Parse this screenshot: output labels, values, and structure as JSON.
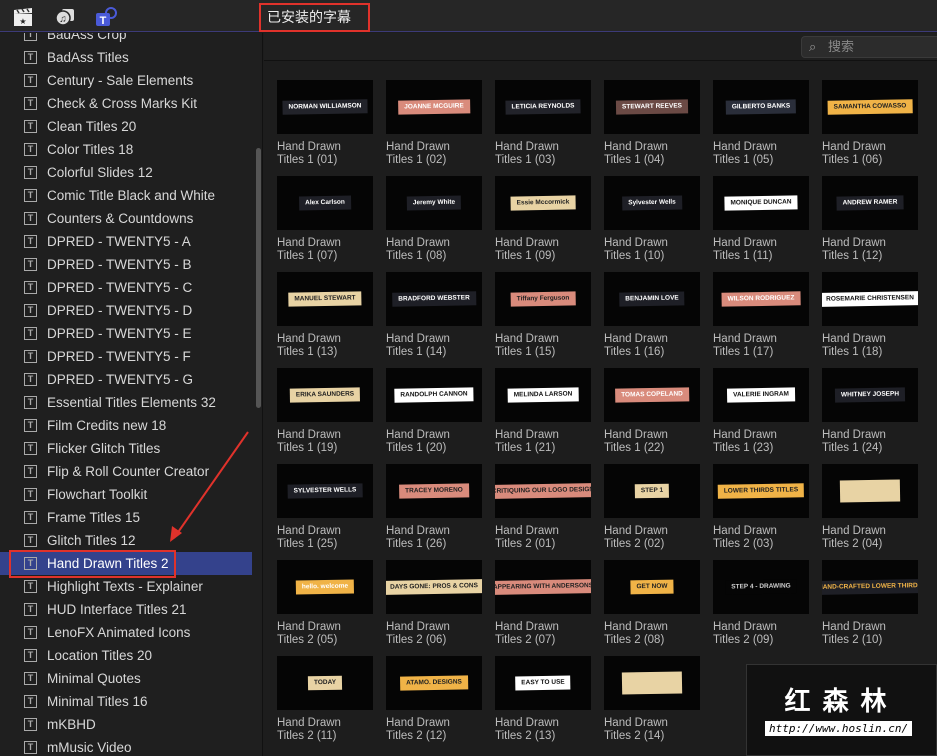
{
  "toolbar": {
    "filter_label": "已安装的字幕",
    "filter_chevron": "⌃⌄",
    "search_placeholder": "搜索",
    "icons": [
      "clapper-icon",
      "music-photo-icon",
      "titles-icon"
    ]
  },
  "sidebar": {
    "selected": "Hand Drawn Titles 2",
    "items": [
      "BadAss Crop",
      "BadAss Titles",
      "Century - Sale Elements",
      "Check & Cross Marks Kit",
      "Clean Titles 20",
      "Color Titles 18",
      "Colorful Slides 12",
      "Comic Title Black and White",
      "Counters & Countdowns",
      "DPRED - TWENTY5 - A",
      "DPRED - TWENTY5 - B",
      "DPRED - TWENTY5 - C",
      "DPRED - TWENTY5 - D",
      "DPRED - TWENTY5 - E",
      "DPRED - TWENTY5 - F",
      "DPRED - TWENTY5 - G",
      "Essential Titles Elements 32",
      "Film Credits new 18",
      "Flicker Glitch Titles",
      "Flip & Roll Counter Creator",
      "Flowchart Toolkit",
      "Frame Titles 15",
      "Glitch Titles 12",
      "Hand Drawn Titles 2",
      "Highlight Texts - Explainer",
      "HUD Interface Titles 21",
      "LenoFX Animated Icons",
      "Location Titles 20",
      "Minimal Quotes",
      "Minimal Titles 16",
      "mKBHD",
      "mMusic Video"
    ]
  },
  "grid": {
    "items": [
      {
        "l1": "Hand Drawn",
        "l2": "Titles 1 (01)",
        "t": "NORMAN WILLIAMSON",
        "bg": "#22232a",
        "fg": "#fff"
      },
      {
        "l1": "Hand Drawn",
        "l2": "Titles 1 (02)",
        "t": "JOANNE MCGUIRE",
        "bg": "#d98b7c",
        "fg": "#fff"
      },
      {
        "l1": "Hand Drawn",
        "l2": "Titles 1 (03)",
        "t": "LETICIA REYNOLDS",
        "bg": "#22232a",
        "fg": "#fff"
      },
      {
        "l1": "Hand Drawn",
        "l2": "Titles 1 (04)",
        "t": "STEWART REEVES",
        "bg": "#6b4a45",
        "fg": "#fff"
      },
      {
        "l1": "Hand Drawn",
        "l2": "Titles 1 (05)",
        "t": "GILBERTO BANKS",
        "bg": "#2a2e3a",
        "fg": "#fff"
      },
      {
        "l1": "Hand Drawn",
        "l2": "Titles 1 (06)",
        "t": "SAMANTHA COWASSO",
        "bg": "#f0b347",
        "fg": "#222"
      },
      {
        "l1": "Hand Drawn",
        "l2": "Titles 1 (07)",
        "t": "Alex Carlson",
        "bg": "#1e1f26",
        "fg": "#fff"
      },
      {
        "l1": "Hand Drawn",
        "l2": "Titles 1 (08)",
        "t": "Jeremy White",
        "bg": "#1e1f26",
        "fg": "#fff"
      },
      {
        "l1": "Hand Drawn",
        "l2": "Titles 1 (09)",
        "t": "Essie Mccormick",
        "bg": "#e8d3a4",
        "fg": "#222"
      },
      {
        "l1": "Hand Drawn",
        "l2": "Titles 1 (10)",
        "t": "Sylvester Wells",
        "bg": "#1e1f26",
        "fg": "#fff"
      },
      {
        "l1": "Hand Drawn",
        "l2": "Titles 1 (11)",
        "t": "MONIQUE DUNCAN",
        "bg": "#ffffff",
        "fg": "#111"
      },
      {
        "l1": "Hand Drawn",
        "l2": "Titles 1 (12)",
        "t": "ANDREW RAMER",
        "bg": "#1e1f26",
        "fg": "#fff"
      },
      {
        "l1": "Hand Drawn",
        "l2": "Titles 1 (13)",
        "t": "MANUEL STEWART",
        "bg": "#e8d3a4",
        "fg": "#222"
      },
      {
        "l1": "Hand Drawn",
        "l2": "Titles 1 (14)",
        "t": "BRADFORD WEBSTER",
        "bg": "#1e1f26",
        "fg": "#fff"
      },
      {
        "l1": "Hand Drawn",
        "l2": "Titles 1 (15)",
        "t": "Tiffany Ferguson",
        "bg": "#d98b7c",
        "fg": "#222"
      },
      {
        "l1": "Hand Drawn",
        "l2": "Titles 1 (16)",
        "t": "BENJAMIN LOVE",
        "bg": "#1e1f26",
        "fg": "#fff"
      },
      {
        "l1": "Hand Drawn",
        "l2": "Titles 1 (17)",
        "t": "WILSON RODRIGUEZ",
        "bg": "#d98b7c",
        "fg": "#fff"
      },
      {
        "l1": "Hand Drawn",
        "l2": "Titles 1 (18)",
        "t": "ROSEMARIE CHRISTENSEN",
        "bg": "#ffffff",
        "fg": "#111"
      },
      {
        "l1": "Hand Drawn",
        "l2": "Titles 1 (19)",
        "t": "ERIKA SAUNDERS",
        "bg": "#e8d3a4",
        "fg": "#222"
      },
      {
        "l1": "Hand Drawn",
        "l2": "Titles 1 (20)",
        "t": "RANDOLPH CANNON",
        "bg": "#ffffff",
        "fg": "#111"
      },
      {
        "l1": "Hand Drawn",
        "l2": "Titles 1 (21)",
        "t": "MELINDA LARSON",
        "bg": "#ffffff",
        "fg": "#111"
      },
      {
        "l1": "Hand Drawn",
        "l2": "Titles 1 (22)",
        "t": "TOMAS COPELAND",
        "bg": "#d98b7c",
        "fg": "#fff"
      },
      {
        "l1": "Hand Drawn",
        "l2": "Titles 1 (23)",
        "t": "VALERIE INGRAM",
        "bg": "#ffffff",
        "fg": "#111"
      },
      {
        "l1": "Hand Drawn",
        "l2": "Titles 1 (24)",
        "t": "WHITNEY JOSEPH",
        "bg": "#1e1f26",
        "fg": "#fff"
      },
      {
        "l1": "Hand Drawn",
        "l2": "Titles 1 (25)",
        "t": "SYLVESTER WELLS",
        "bg": "#1e1f26",
        "fg": "#fff"
      },
      {
        "l1": "Hand Drawn",
        "l2": "Titles 1 (26)",
        "t": "TRACEY MORENO",
        "bg": "#d98b7c",
        "fg": "#222"
      },
      {
        "l1": "Hand Drawn",
        "l2": "Titles 2 (01)",
        "t": "CRITIQUING OUR LOGO DESIGN",
        "bg": "#d98b7c",
        "fg": "#222"
      },
      {
        "l1": "Hand Drawn",
        "l2": "Titles 2 (02)",
        "t": "STEP 1",
        "bg": "#e8d3a4",
        "fg": "#222"
      },
      {
        "l1": "Hand Drawn",
        "l2": "Titles 2 (03)",
        "t": "LOWER THIRDS TITLES",
        "bg": "#f0b347",
        "fg": "#222"
      },
      {
        "l1": "Hand Drawn",
        "l2": "Titles 2 (04)",
        "t": "",
        "bg": "#e8d3a4",
        "fg": "#222"
      },
      {
        "l1": "Hand Drawn",
        "l2": "Titles 2 (05)",
        "t": "hello. welcome",
        "bg": "#f0b347",
        "fg": "#fff"
      },
      {
        "l1": "Hand Drawn",
        "l2": "Titles 2 (06)",
        "t": "DAYS GONE: PROS & CONS",
        "bg": "#e8d3a4",
        "fg": "#222"
      },
      {
        "l1": "Hand Drawn",
        "l2": "Titles 2 (07)",
        "t": "APPEARING WITH ANDERSONS",
        "bg": "#d98b7c",
        "fg": "#222"
      },
      {
        "l1": "Hand Drawn",
        "l2": "Titles 2 (08)",
        "t": "GET NOW",
        "bg": "#f0b347",
        "fg": "#222"
      },
      {
        "l1": "Hand Drawn",
        "l2": "Titles 2 (09)",
        "t": "STEP 4 - DRAWING",
        "bg": "#050505",
        "fg": "#ccc"
      },
      {
        "l1": "Hand Drawn",
        "l2": "Titles 2 (10)",
        "t": "HAND-CRAFTED LOWER THIRDS",
        "bg": "#1e1f26",
        "fg": "#f0b347"
      },
      {
        "l1": "Hand Drawn",
        "l2": "Titles 2 (11)",
        "t": "TODAY",
        "bg": "#e8d3a4",
        "fg": "#222"
      },
      {
        "l1": "Hand Drawn",
        "l2": "Titles 2 (12)",
        "t": "ATAMO. DESIGNS",
        "bg": "#f0b347",
        "fg": "#222"
      },
      {
        "l1": "Hand Drawn",
        "l2": "Titles 2 (13)",
        "t": "EASY TO USE",
        "bg": "#ffffff",
        "fg": "#111"
      },
      {
        "l1": "Hand Drawn",
        "l2": "Titles 2 (14)",
        "t": "",
        "bg": "#e8d3a4",
        "fg": "#222"
      }
    ]
  },
  "watermark": {
    "cn": "红森林",
    "url": "http://www.hoslin.cn/"
  }
}
